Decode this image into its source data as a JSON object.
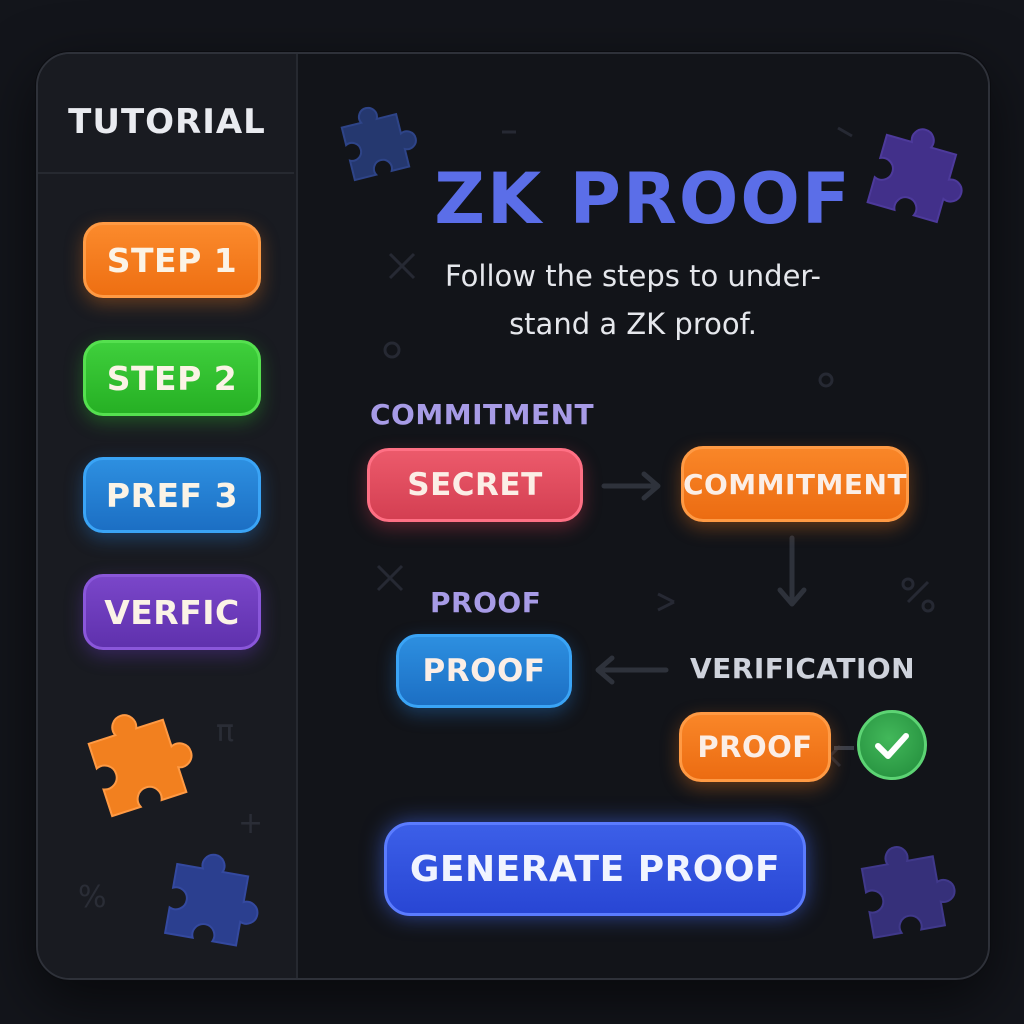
{
  "sidebar": {
    "title": "TUTORIAL",
    "items": [
      {
        "label": "STEP 1",
        "color": "#f07a1f"
      },
      {
        "label": "STEP 2",
        "color": "#33c12f"
      },
      {
        "label": "PREF 3",
        "color": "#2483d6"
      },
      {
        "label": "VERFIC",
        "color": "#6a3cbb"
      }
    ]
  },
  "main": {
    "title": "ZK PROOF",
    "subtitle_line1": "Follow the steps to under-",
    "subtitle_line2": "stand a ZK proof.",
    "flow": {
      "commitment_label": "COMMITMENT",
      "secret_button": "SECRET",
      "commitment_button": "COMMITMENT",
      "proof_label": "PROOF",
      "proof_button": "PROOF",
      "verification_label": "VERIFICATION",
      "verification_proof_button": "PROOF"
    },
    "generate_button": "GENERATE PROOF"
  },
  "icons": [
    "puzzle-piece-icon",
    "arrow-right-icon",
    "arrow-down-icon",
    "arrow-left-icon",
    "checkmark-icon"
  ],
  "colors": {
    "accent_title": "#5b6ee8",
    "secret": "#e14b5d",
    "commitment": "#f37a1f",
    "proof": "#2483d6",
    "verified": "#2fa24b",
    "generate": "#3454e0"
  }
}
